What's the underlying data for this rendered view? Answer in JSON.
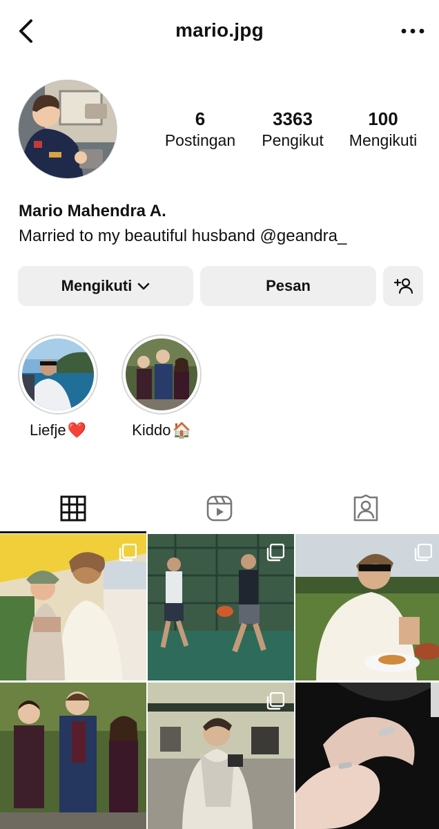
{
  "header": {
    "title": "mario.jpg",
    "back_icon": "chevron-left-icon",
    "more_icon": "more-horizontal-icon"
  },
  "profile": {
    "stats": [
      {
        "value": "6",
        "label": "Postingan"
      },
      {
        "value": "3363",
        "label": "Pengikut"
      },
      {
        "value": "100",
        "label": "Mengikuti"
      }
    ],
    "name": "Mario Mahendra A.",
    "bio": "Married to my beautiful husband @geandra_"
  },
  "actions": {
    "following_label": "Mengikuti",
    "message_label": "Pesan",
    "add_person_icon": "add-person-icon"
  },
  "highlights": [
    {
      "label": "Liefje",
      "emoji": "❤️"
    },
    {
      "label": "Kiddo",
      "emoji": "🏠"
    }
  ],
  "tabs": [
    {
      "name": "grid",
      "icon": "grid-icon",
      "active": true
    },
    {
      "name": "reels",
      "icon": "reels-icon",
      "active": false
    },
    {
      "name": "tagged",
      "icon": "tagged-icon",
      "active": false
    }
  ],
  "posts": [
    {
      "subject": "beach-baby",
      "multiple": true
    },
    {
      "subject": "padel-court",
      "multiple": true
    },
    {
      "subject": "garden-dinner",
      "multiple": true
    },
    {
      "subject": "three-children",
      "multiple": false
    },
    {
      "subject": "terrace-coffee",
      "multiple": true
    },
    {
      "subject": "hands-rings",
      "multiple": false
    }
  ]
}
